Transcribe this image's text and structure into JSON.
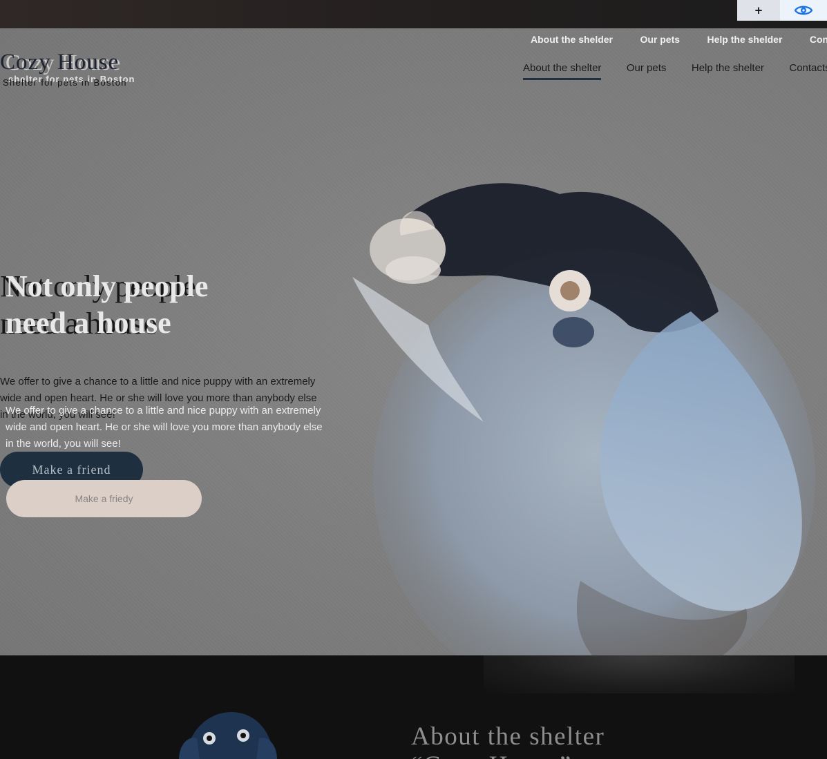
{
  "overlay": {
    "add_label": "+",
    "eye_icon": "eye-icon",
    "eye_color": "#1a73e8"
  },
  "ghost_header": {
    "logo_title": "Cozy House",
    "logo_subtitle": "shelter for pets in Boston",
    "nav": [
      "About the shelder",
      "Our pets",
      "Help the shelder",
      "Contacts"
    ]
  },
  "header": {
    "logo_title": "Cozy House",
    "logo_subtitle": "Shelter for pets in Boston",
    "nav": [
      {
        "label": "About the shelter",
        "active": true
      },
      {
        "label": "Our pets",
        "active": false
      },
      {
        "label": "Help the shelter",
        "active": false
      },
      {
        "label": "Contacts",
        "active": false
      }
    ]
  },
  "hero": {
    "title": "Not only people need a house",
    "ghost_title": "Not only people need a house",
    "text": "We offer to give a chance to a little and nice puppy with an extremely wide and open heart. He or she will love you more than anybody else in the world, you will see!",
    "ghost_text": "We offer to give a chance to a little and nice puppy with an extremely wide and open heart. He or she will love you more than anybody else in the world, you will see!",
    "button_label": "Make a friend",
    "ghost_button_label": "Make a friedy"
  },
  "about": {
    "title": "About the shelter",
    "subtitle": "“Cozy House”"
  },
  "colors": {
    "accent_dark": "#1e2f3f",
    "accent_light": "#dccfc8",
    "hero_bg": "#808080",
    "about_bg": "#111111"
  }
}
